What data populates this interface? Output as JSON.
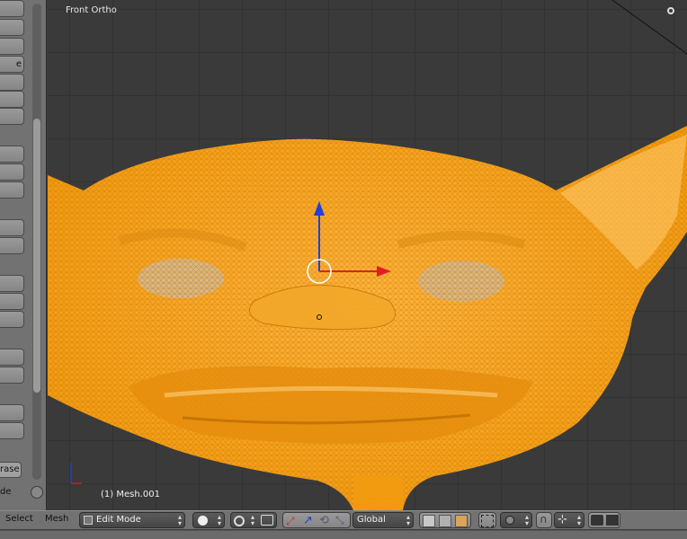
{
  "viewport": {
    "view_label": "Front Ortho",
    "object_label": "(1) Mesh.001"
  },
  "shelf": {
    "cut_label": "e",
    "erase_label": "rase",
    "mode_label": "de"
  },
  "header": {
    "menu_select": "Select",
    "menu_mesh": "Mesh",
    "mode_value": "Edit Mode",
    "orientation_value": "Global"
  },
  "colors": {
    "mesh": "#ffa31a",
    "wire": "#c67700",
    "axis_x": "#e02020",
    "axis_z": "#2040e0"
  }
}
